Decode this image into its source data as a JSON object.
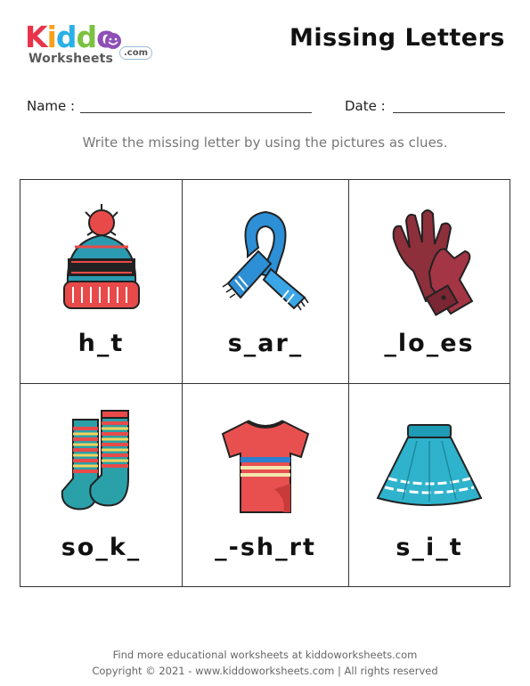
{
  "logo": {
    "kiddo": [
      "K",
      "i",
      "d",
      "d",
      "o"
    ],
    "kiddo_colors": [
      "#e8334a",
      "#f7a21b",
      "#2ab0e6",
      "#7cc242",
      "#8e4fb6"
    ],
    "worksheets": "Worksheets",
    "dotcom": ".com"
  },
  "title": "Missing Letters",
  "fields": {
    "name_label": "Name :",
    "date_label": "Date :"
  },
  "instruction": "Write the missing letter by using the pictures as clues.",
  "items": [
    {
      "icon": "beanie-hat-icon",
      "word": "h_t"
    },
    {
      "icon": "scarf-icon",
      "word": "s_ar_"
    },
    {
      "icon": "gloves-icon",
      "word": "_lo_es"
    },
    {
      "icon": "socks-icon",
      "word": "so_k_"
    },
    {
      "icon": "t-shirt-icon",
      "word": "_-sh_rt"
    },
    {
      "icon": "skirt-icon",
      "word": "s_i_t"
    }
  ],
  "footer": {
    "line1": "Find more educational worksheets at kiddoworksheets.com",
    "line2": "Copyright © 2021 - www.kiddoworksheets.com  |  All rights reserved"
  }
}
